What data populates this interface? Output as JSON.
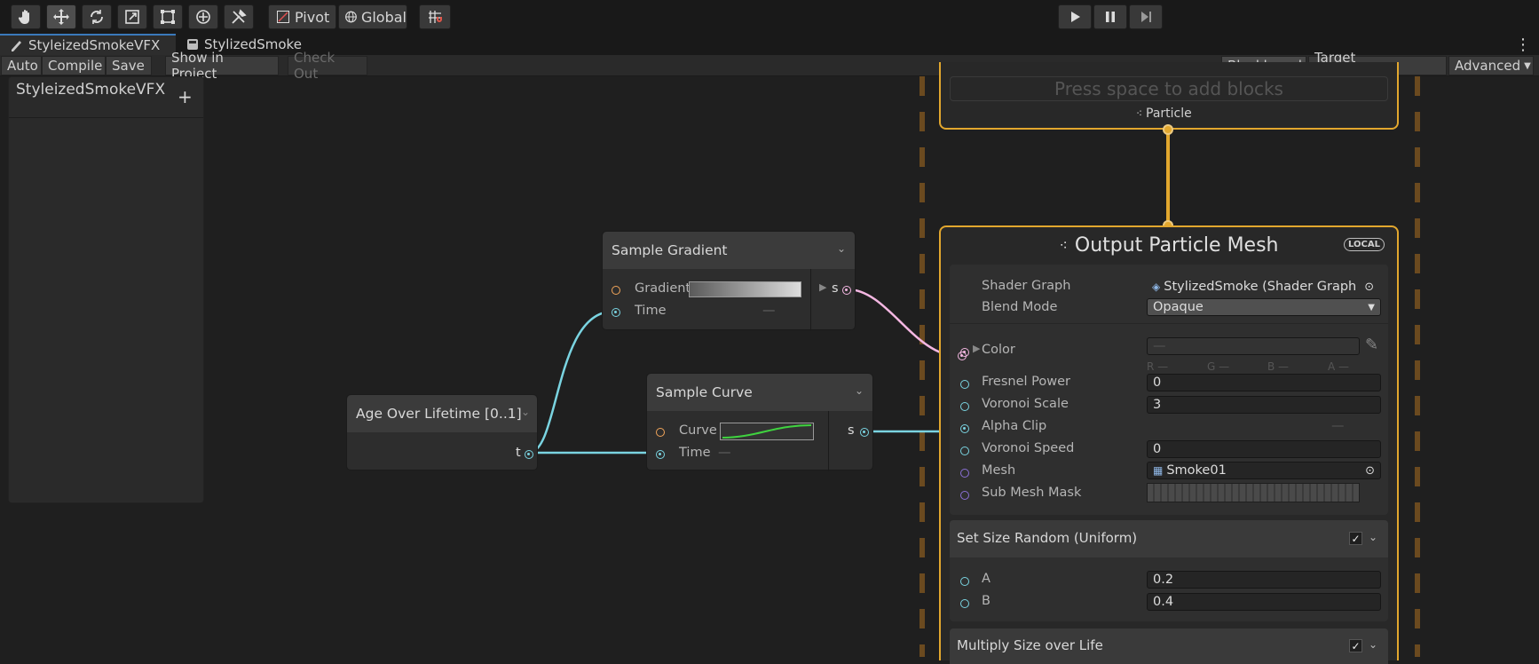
{
  "toolbar": {
    "tools": [
      "hand-icon",
      "move-icon",
      "rotate-icon",
      "scale-icon",
      "rect-icon",
      "transform-icon",
      "custom-tool-icon"
    ],
    "pivot_label": "Pivot",
    "global_label": "Global",
    "play_controls": [
      "play-icon",
      "pause-icon",
      "step-icon"
    ]
  },
  "tabs": [
    {
      "label": "StyleizedSmokeVFX",
      "active": true
    },
    {
      "label": "StylizedSmoke",
      "active": false
    }
  ],
  "vfx_toolbar": {
    "auto": "Auto",
    "compile": "Compile",
    "save": "Save",
    "show_in_project": "Show in Project",
    "check_out": "Check Out",
    "blackboard": "Blackboard",
    "target_gameobject": "Target GameObject",
    "advanced": "Advanced"
  },
  "blackboard": {
    "title": "StyleizedSmokeVFX",
    "add": "+"
  },
  "nodes": {
    "sample_gradient": {
      "title": "Sample Gradient",
      "gradient_label": "Gradient",
      "time_label": "Time",
      "time_value": "—",
      "output": "s"
    },
    "age": {
      "title": "Age Over Lifetime [0..1]",
      "output": "t"
    },
    "sample_curve": {
      "title": "Sample Curve",
      "curve_label": "Curve",
      "time_label": "Time",
      "time_value": "—",
      "output": "s"
    }
  },
  "system": {
    "add_blocks_hint": "Press space to add blocks",
    "particle_label": "Particle",
    "output_title": "Output Particle Mesh",
    "local_badge": "LOCAL",
    "props": {
      "shader_graph_label": "Shader Graph",
      "shader_graph_value": "StylizedSmoke (Shader Graph V",
      "blend_mode_label": "Blend Mode",
      "blend_mode_value": "Opaque",
      "color_label": "Color",
      "color_value": "—",
      "rgba": [
        "R —",
        "G —",
        "B —",
        "A —"
      ],
      "fresnel_label": "Fresnel Power",
      "fresnel_value": "0",
      "voronoi_scale_label": "Voronoi Scale",
      "voronoi_scale_value": "3",
      "alpha_clip_label": "Alpha Clip",
      "alpha_clip_value": "—",
      "voronoi_speed_label": "Voronoi Speed",
      "voronoi_speed_value": "0",
      "mesh_label": "Mesh",
      "mesh_value": "Smoke01",
      "submesh_label": "Sub Mesh Mask"
    },
    "set_size": {
      "title": "Set Size Random (Uniform)",
      "a_label": "A",
      "a_value": "0.2",
      "b_label": "B",
      "b_value": "0.4"
    },
    "multiply_size": {
      "title": "Multiply Size over Life"
    }
  },
  "colors": {
    "accent": "#e2a72e",
    "wire_time": "#7ad4e1",
    "wire_color": "#f4b7e2",
    "dash": "#6b4a1f"
  }
}
